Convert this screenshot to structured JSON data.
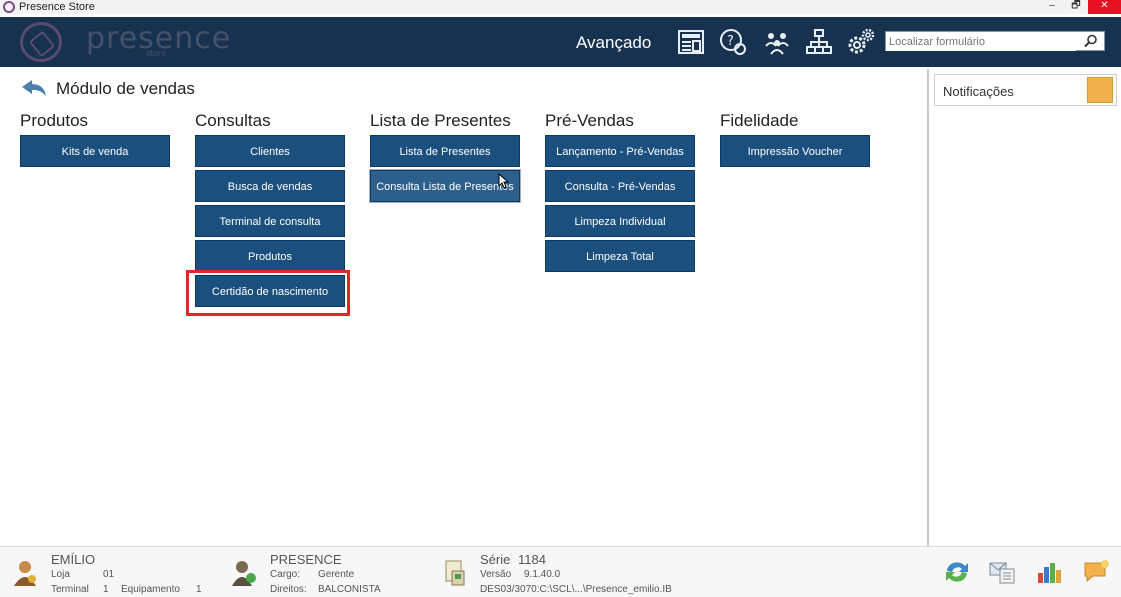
{
  "window": {
    "title": "Presence Store",
    "minimize": "–",
    "restore": "🗗",
    "close": "✕"
  },
  "header": {
    "logo_text": "presence",
    "logo_sub": "store",
    "mode_label": "Avançado",
    "icons": [
      "news-icon",
      "help-icon",
      "users-icon",
      "network-icon",
      "settings-icon"
    ],
    "search_placeholder": "Localizar formulário"
  },
  "module": {
    "title": "Módulo de vendas"
  },
  "columns": [
    {
      "heading": "Produtos",
      "buttons": [
        "Kits de venda"
      ]
    },
    {
      "heading": "Consultas",
      "buttons": [
        "Clientes",
        "Busca de vendas",
        "Terminal de consulta",
        "Produtos",
        "Certidão de nascimento"
      ]
    },
    {
      "heading": "Lista de Presentes",
      "buttons": [
        "Lista de Presentes",
        "Consulta Lista de Presentes"
      ]
    },
    {
      "heading": "Pré-Vendas",
      "buttons": [
        "Lançamento - Pré-Vendas",
        "Consulta - Pré-Vendas",
        "Limpeza Individual",
        "Limpeza Total"
      ]
    },
    {
      "heading": "Fidelidade",
      "buttons": [
        "Impressão Voucher"
      ]
    }
  ],
  "notifications": {
    "label": "Notificações"
  },
  "status": {
    "user": {
      "name": "EMÍLIO",
      "loja_label": "Loja",
      "loja_value": "01",
      "terminal_label": "Terminal",
      "terminal_value": "1",
      "equip_label": "Equipamento",
      "equip_value": "1"
    },
    "company": {
      "name": "PRESENCE",
      "cargo_label": "Cargo:",
      "cargo_value": "Gerente",
      "direitos_label": "Direitos:",
      "direitos_value": "BALCONISTA"
    },
    "system": {
      "serie_label": "Série",
      "serie_value": "1184",
      "versao_label": "Versão",
      "versao_value": "9.1.40.0",
      "path": "DES03/3070:C:\\SCL\\...\\Presence_emilio.IB"
    }
  },
  "colors": {
    "header_bg": "#17324f",
    "button_bg": "#1b4f7e",
    "highlight": "#e0262a"
  }
}
